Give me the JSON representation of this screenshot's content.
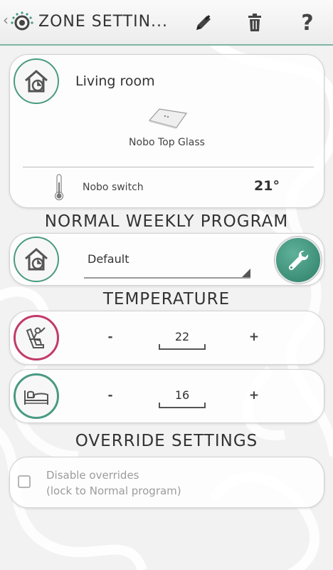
{
  "header": {
    "title": "ZONE SETTIN...",
    "back_icon": "chevron-left-icon",
    "logo_icon": "app-logo-icon",
    "actions": {
      "edit_icon": "pencil-icon",
      "delete_icon": "trash-icon",
      "help_label": "?"
    }
  },
  "zone": {
    "name": "Living room",
    "device_name": "Nobo Top Glass",
    "sensor_name": "Nobo switch",
    "sensor_temp": "21°"
  },
  "sections": {
    "program_heading": "NORMAL WEEKLY PROGRAM",
    "temperature_heading": "TEMPERATURE",
    "override_heading": "OVERRIDE SETTINGS"
  },
  "program": {
    "selected": "Default"
  },
  "temperature": {
    "comfort": {
      "minus": "-",
      "value": "22",
      "plus": "+"
    },
    "eco": {
      "minus": "-",
      "value": "16",
      "plus": "+"
    }
  },
  "override": {
    "label_line1": "Disable overrides",
    "label_line2": "(lock to Normal program)",
    "checked": false
  },
  "colors": {
    "accent_green": "#4a9a82",
    "comfort_pink": "#c23a6a",
    "wrench_green": "#3d8f78"
  }
}
